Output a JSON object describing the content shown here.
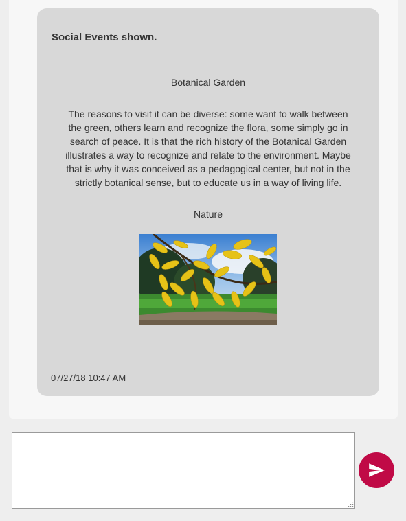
{
  "message": {
    "heading": "Social Events shown.",
    "post_title": "Botanical Garden",
    "post_body": "The reasons to visit it can be diverse: some want to walk between the green, others learn and recognize the flora, some simply go in search of peace. It is that the rich history of the Botanical Garden illustrates a way to recognize and relate to the environment. Maybe that is why it was conceived as a pedagogical center, but not in the strictly botanical sense, but to educate us in a way of living life.",
    "image_caption": "Nature",
    "timestamp": "07/27/18 10:47 AM"
  },
  "composer": {
    "value": "",
    "send_icon": "send-arrow-icon"
  },
  "colors": {
    "bubble_bg": "#d8d8d8",
    "send_button": "#c00a46",
    "page_bg": "#eeeeee"
  }
}
